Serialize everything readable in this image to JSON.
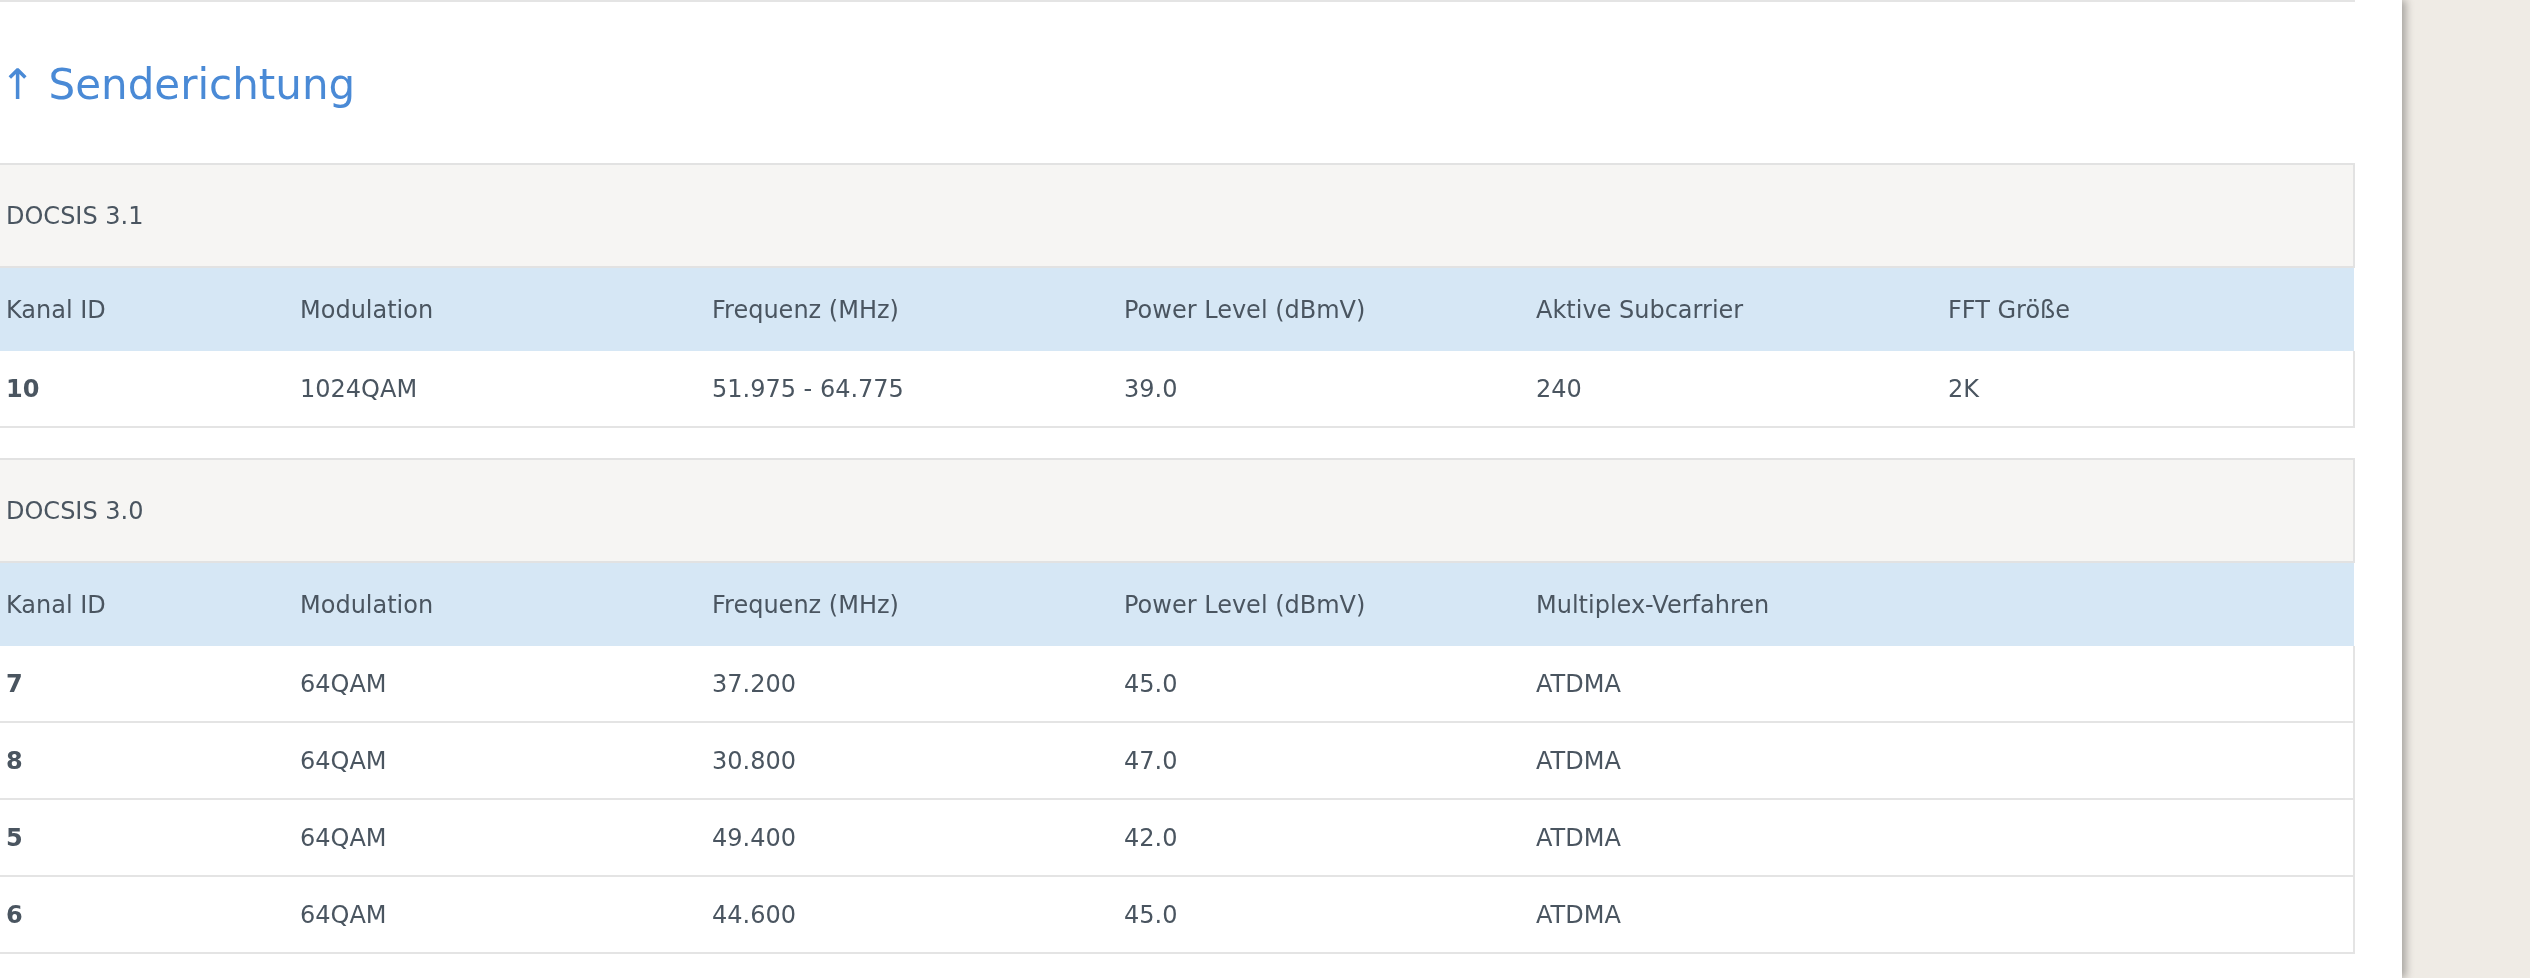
{
  "section_title": "↑ Senderichtung",
  "tables": [
    {
      "title": "DOCSIS 3.1",
      "columns": [
        "Kanal ID",
        "Modulation",
        "Frequenz (MHz)",
        "Power Level (dBmV)",
        "Aktive Subcarrier",
        "FFT Größe"
      ],
      "rows": [
        [
          "10",
          "1024QAM",
          "51.975 - 64.775",
          "39.0",
          "240",
          "2K"
        ]
      ]
    },
    {
      "title": "DOCSIS 3.0",
      "columns": [
        "Kanal ID",
        "Modulation",
        "Frequenz (MHz)",
        "Power Level (dBmV)",
        "Multiplex-Verfahren"
      ],
      "rows": [
        [
          "7",
          "64QAM",
          "37.200",
          "45.0",
          "ATDMA"
        ],
        [
          "8",
          "64QAM",
          "30.800",
          "47.0",
          "ATDMA"
        ],
        [
          "5",
          "64QAM",
          "49.400",
          "42.0",
          "ATDMA"
        ],
        [
          "6",
          "64QAM",
          "44.600",
          "45.0",
          "ATDMA"
        ]
      ]
    }
  ]
}
